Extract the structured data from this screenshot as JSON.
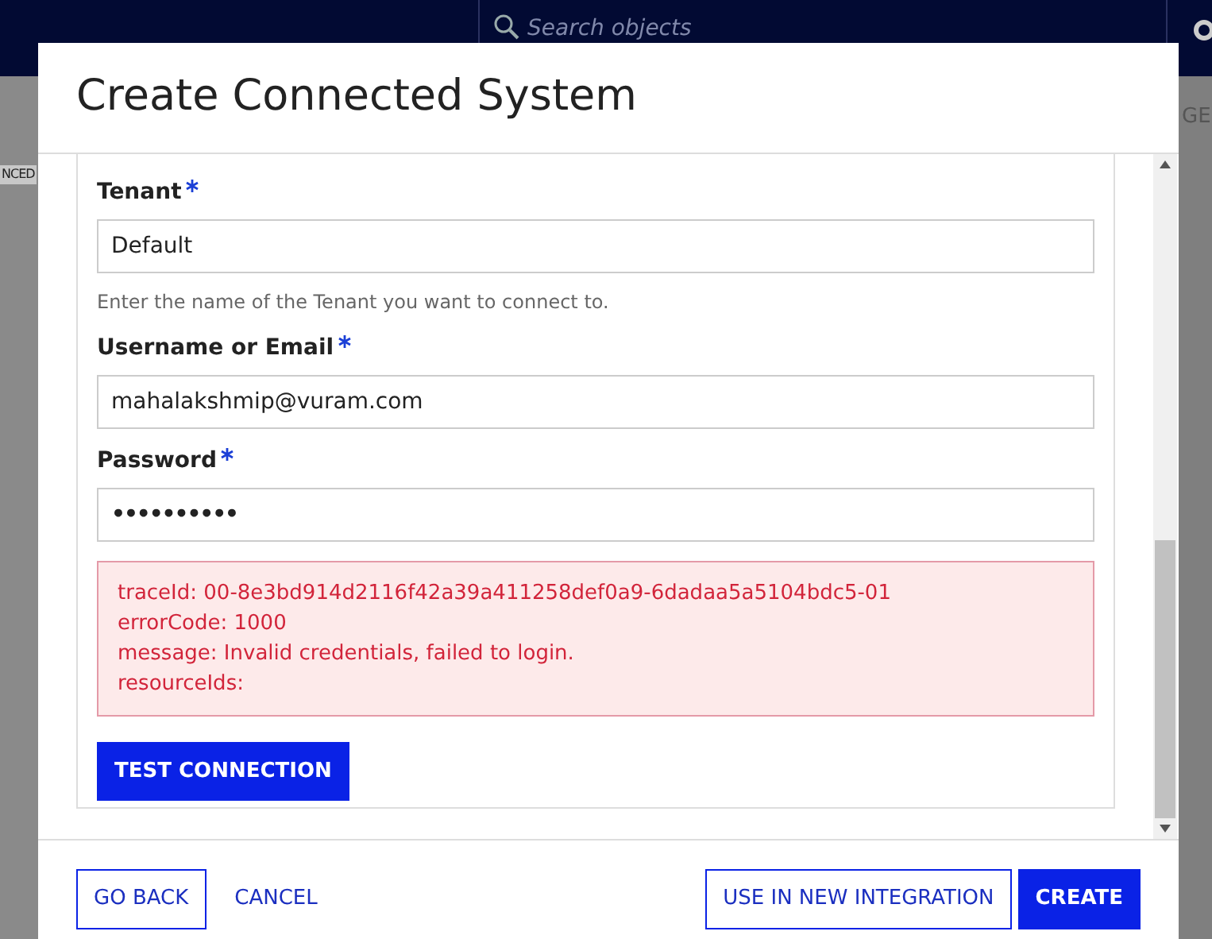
{
  "background": {
    "search": {
      "placeholder": "Search objects"
    },
    "left_tab": "NCED",
    "right_tab": "GE"
  },
  "dialog": {
    "title": "Create Connected System",
    "fields": [
      {
        "label": "Tenant",
        "required": true,
        "value": "Default",
        "help": "Enter the name of the Tenant you want to connect to.",
        "kind": "text"
      },
      {
        "label": "Username or Email",
        "required": true,
        "value": "mahalakshmip@vuram.com",
        "kind": "text"
      },
      {
        "label": "Password",
        "required": true,
        "value": "••••••••••",
        "kind": "password"
      }
    ],
    "error_lines": [
      "traceId: 00-8e3bd914d2116f42a39a411258def0a9-6dadaa5a5104bdc5-01",
      "errorCode: 1000",
      "message: Invalid credentials, failed to login.",
      "resourceIds:"
    ],
    "test_button": "TEST CONNECTION",
    "footer_left": [
      {
        "label": "GO BACK",
        "kind": "outline"
      },
      {
        "label": "CANCEL",
        "kind": "link"
      }
    ],
    "footer_right": [
      {
        "label": "USE IN NEW INTEGRATION",
        "kind": "outline"
      },
      {
        "label": "CREATE",
        "kind": "primary"
      }
    ]
  }
}
